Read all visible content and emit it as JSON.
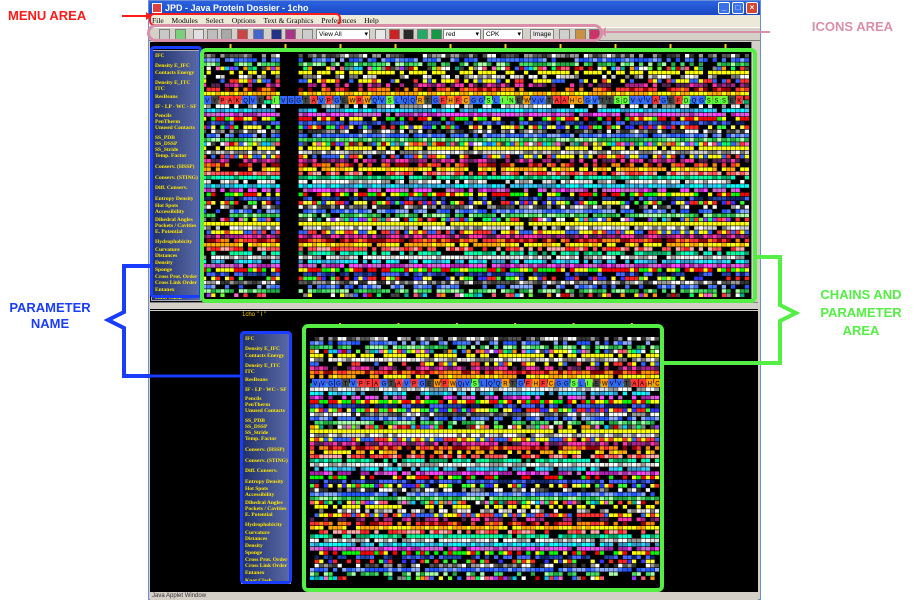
{
  "window": {
    "title": "JPD - Java Protein Dossier - 1cho",
    "minimize": "_",
    "maximize": "□",
    "close": "×"
  },
  "menu": [
    "File",
    "Modules",
    "Select",
    "Options",
    "Text & Graphics",
    "Preferences",
    "Help"
  ],
  "toolbar": {
    "view_select": "View All",
    "color_select": "red",
    "render_select": "CPK",
    "image_button": "Image"
  },
  "chain_label": "1cho \" I \"",
  "status_text": "Java Applet Window",
  "parameter_names": [
    "IFC",
    "Density E_IFC",
    "Contacts Energy",
    "Density E_ITC",
    "ITC",
    "ResBeans",
    "IF - LP - WC - SF",
    "Pencils",
    "PenTherm",
    "Unused Contacts",
    "SS_PDB",
    "SS_DSSP",
    "SS_Stride",
    "Temp. Factor",
    "Conserv. (HSSP)",
    "Conserv. (STING)",
    "Diff. Conserv.",
    "Entropy Density",
    "Hot Spots",
    "Accessibility",
    "Dihedral Angles",
    "Pockets / Cavities",
    "E. Potential",
    "Hydrophobicity",
    "Curvature",
    "Distances",
    "Density",
    "Sponge",
    "Cross Prot. Order",
    "Cross Link Order",
    "Entanex",
    "Knot Clash"
  ],
  "sequence_top": "VYPAKQVE IVGGTAVPGEWPWQVSLQQRTGFHFCGGSLINEWVVTAAHCGVTTSDVVVAGEFDQGSSSEK",
  "sequence_bottom": "VVGGTVPFAGTAVPGEWPWQVSLQQRTGFHFCGGSLIEWVVTAAHCGVTTSDVV",
  "annotations": {
    "menu_area": "MENU AREA",
    "icons_area": "ICONS AREA",
    "parameter_name": "PARAMETER NAME",
    "chains_area": "CHAINS AND PARAMETER AREA"
  },
  "colors": {
    "menu_area": "#ff1a1a",
    "icons_area": "#d98fa8",
    "parameter_name": "#1a3cff",
    "chains_area": "#55ee44"
  }
}
